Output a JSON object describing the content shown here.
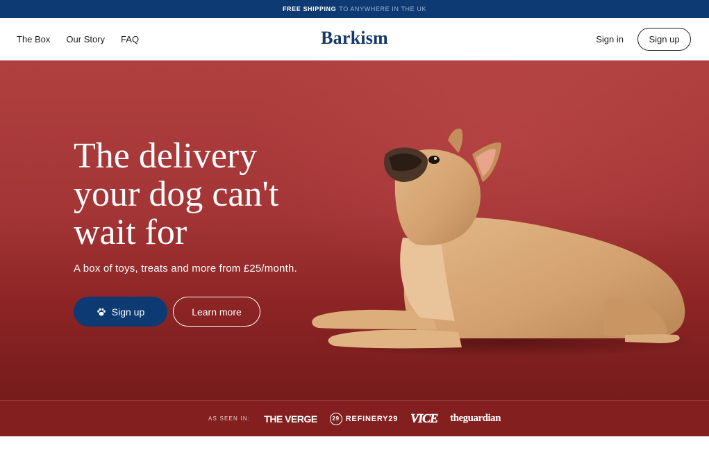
{
  "promo": {
    "strong": "FREE SHIPPING",
    "rest": "TO ANYWHERE IN THE UK"
  },
  "nav": {
    "items": [
      {
        "label": "The Box"
      },
      {
        "label": "Our Story"
      },
      {
        "label": "FAQ"
      }
    ],
    "logo": "Barkism",
    "signin": "Sign in",
    "signup": "Sign up"
  },
  "hero": {
    "headline_lines": [
      "The delivery",
      "your dog can't",
      "wait for"
    ],
    "subline": "A box of toys, treats and more from £25/month.",
    "primary_button": {
      "label": "Sign up",
      "icon": "paw-icon"
    },
    "secondary_button": {
      "label": "Learn more"
    }
  },
  "press": {
    "label": "AS SEEN IN:",
    "logos": [
      "THE VERGE",
      "REFINERY29",
      "VICE",
      "theguardian"
    ],
    "r29_badge": "29"
  },
  "colors": {
    "navy": "#0d3a72",
    "hero_red": "#a33536",
    "logo_blue": "#13386b"
  }
}
